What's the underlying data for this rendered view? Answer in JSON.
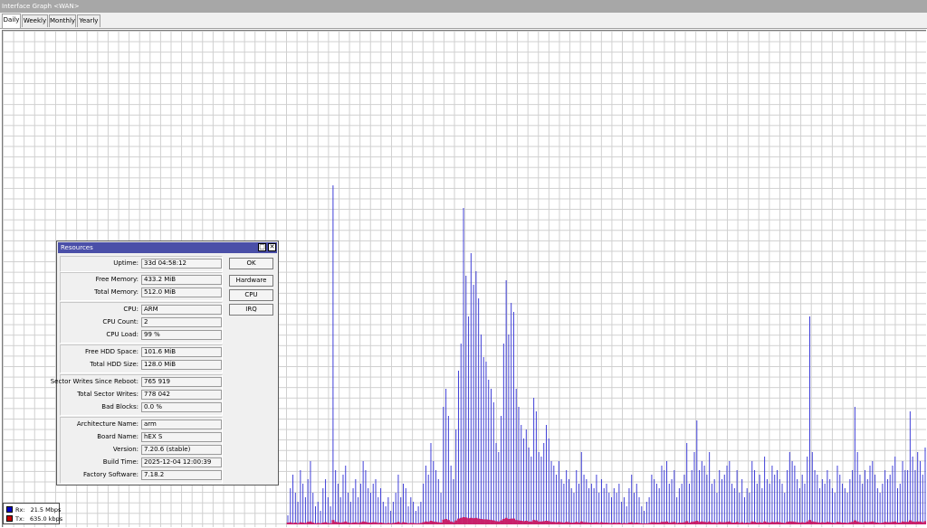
{
  "window": {
    "title": "Interface Graph <WAN>"
  },
  "tabs": [
    {
      "label": "Daily",
      "active": true
    },
    {
      "label": "Weekly",
      "active": false
    },
    {
      "label": "Monthly",
      "active": false
    },
    {
      "label": "Yearly",
      "active": false
    }
  ],
  "legend": {
    "rx": {
      "label": "Rx:",
      "value": "21.5 Mbps",
      "color": "#0000c8"
    },
    "tx": {
      "label": "Tx:",
      "value": "635.0 kbps",
      "color": "#c80000"
    }
  },
  "graph_colors": {
    "rx_stroke": "#4040d8",
    "tx_fill": "#c8206a",
    "grid": "#cfcfcf"
  },
  "chart_data": {
    "type": "bar",
    "rx_series": [
      2,
      8,
      11,
      7,
      5,
      12,
      9,
      6,
      10,
      14,
      7,
      4,
      5,
      3,
      8,
      10,
      6,
      4,
      75,
      12,
      9,
      6,
      11,
      13,
      7,
      5,
      8,
      10,
      6,
      9,
      14,
      12,
      8,
      7,
      9,
      10,
      6,
      8,
      5,
      4,
      6,
      3,
      5,
      7,
      11,
      6,
      9,
      8,
      4,
      6,
      5,
      3,
      4,
      5,
      9,
      13,
      11,
      18,
      14,
      12,
      10,
      7,
      26,
      30,
      24,
      13,
      10,
      21,
      34,
      40,
      70,
      55,
      46,
      60,
      53,
      56,
      50,
      42,
      37,
      36,
      32,
      30,
      27,
      18,
      16,
      24,
      40,
      54,
      42,
      49,
      47,
      30,
      26,
      22,
      19,
      21,
      17,
      15,
      28,
      25,
      16,
      15,
      18,
      22,
      19,
      14,
      13,
      11,
      14,
      10,
      9,
      12,
      10,
      8,
      7,
      12,
      9,
      16,
      11,
      10,
      8,
      9,
      8,
      11,
      7,
      10,
      8,
      9,
      7,
      6,
      8,
      7,
      9,
      5,
      6,
      4,
      8,
      11,
      7,
      9,
      6,
      4,
      3,
      5,
      6,
      11,
      10,
      9,
      8,
      13,
      12,
      14,
      9,
      10,
      12,
      6,
      8,
      9,
      11,
      18,
      9,
      12,
      16,
      23,
      12,
      14,
      13,
      11,
      16,
      9,
      10,
      7,
      12,
      10,
      11,
      13,
      14,
      9,
      8,
      12,
      7,
      10,
      6,
      8,
      7,
      14,
      12,
      9,
      11,
      8,
      15,
      10,
      9,
      13,
      11,
      12,
      10,
      9,
      7,
      12,
      16,
      14,
      13,
      10,
      8,
      11,
      9,
      15,
      46,
      16,
      12,
      11,
      8,
      10,
      9,
      12,
      10,
      8,
      7,
      13,
      11,
      9,
      8,
      7,
      10,
      12,
      26,
      16,
      11,
      9,
      12,
      10,
      13,
      14,
      11,
      8,
      7,
      9,
      12,
      10,
      11,
      13,
      15,
      8,
      9,
      14,
      12,
      12,
      25,
      15,
      12,
      16,
      14,
      11,
      17
    ],
    "tx_series": [
      0.5,
      0.6,
      0.4,
      0.5,
      0.3,
      0.6,
      0.5,
      0.4,
      0.7,
      0.8,
      0.5,
      0.3,
      0.4,
      0.3,
      0.5,
      0.6,
      0.4,
      0.3,
      1.2,
      0.7,
      0.6,
      0.5,
      0.6,
      0.8,
      0.5,
      0.4,
      0.5,
      0.6,
      0.4,
      0.6,
      0.8,
      0.7,
      0.5,
      0.5,
      0.6,
      0.6,
      0.4,
      0.5,
      0.4,
      0.3,
      0.4,
      0.3,
      0.4,
      0.5,
      0.7,
      0.4,
      0.6,
      0.5,
      0.3,
      0.4,
      0.4,
      0.3,
      0.3,
      0.4,
      0.6,
      0.8,
      0.7,
      1.0,
      0.8,
      0.7,
      0.6,
      0.5,
      1.3,
      1.5,
      1.2,
      0.8,
      0.6,
      1.1,
      1.6,
      1.8,
      2.0,
      1.9,
      1.7,
      1.8,
      1.7,
      1.8,
      1.6,
      1.5,
      1.4,
      1.4,
      1.3,
      1.2,
      1.1,
      0.9,
      0.8,
      1.1,
      1.5,
      1.8,
      1.5,
      1.6,
      1.6,
      1.2,
      1.1,
      1.0,
      0.9,
      1.0,
      0.8,
      0.8,
      1.2,
      1.1,
      0.8,
      0.8,
      0.9,
      1.0,
      0.9,
      0.7,
      0.7,
      0.6,
      0.7,
      0.6,
      0.5,
      0.7,
      0.6,
      0.5,
      0.5,
      0.7,
      0.5,
      0.8,
      0.6,
      0.6,
      0.5,
      0.5,
      0.5,
      0.6,
      0.4,
      0.6,
      0.5,
      0.5,
      0.4,
      0.4,
      0.5,
      0.4,
      0.5,
      0.3,
      0.4,
      0.3,
      0.5,
      0.6,
      0.4,
      0.5,
      0.4,
      0.3,
      0.3,
      0.3,
      0.4,
      0.6,
      0.6,
      0.5,
      0.5,
      0.7,
      0.7,
      0.8,
      0.5,
      0.6,
      0.7,
      0.4,
      0.5,
      0.5,
      0.6,
      0.9,
      0.5,
      0.7,
      0.8,
      1.0,
      0.7,
      0.8,
      0.7,
      0.6,
      0.8,
      0.5,
      0.6,
      0.4,
      0.7,
      0.6,
      0.6,
      0.7,
      0.8,
      0.5,
      0.5,
      0.7,
      0.4,
      0.6,
      0.4,
      0.5,
      0.4,
      0.8,
      0.7,
      0.5,
      0.6,
      0.5,
      0.8,
      0.6,
      0.5,
      0.7,
      0.6,
      0.7,
      0.6,
      0.5,
      0.4,
      0.7,
      0.8,
      0.8,
      0.7,
      0.6,
      0.5,
      0.6,
      0.5,
      0.8,
      1.2,
      0.8,
      0.7,
      0.6,
      0.5,
      0.6,
      0.5,
      0.7,
      0.6,
      0.5,
      0.4,
      0.7,
      0.6,
      0.5,
      0.5,
      0.4,
      0.6,
      0.7,
      1.1,
      0.8,
      0.6,
      0.5,
      0.7,
      0.6,
      0.7,
      0.8,
      0.6,
      0.5,
      0.4,
      0.5,
      0.7,
      0.6,
      0.6,
      0.7,
      0.8,
      0.5,
      0.5,
      0.8,
      0.7,
      0.7,
      1.1,
      0.8,
      0.7,
      0.8,
      0.8,
      0.6,
      0.9
    ]
  },
  "dialog": {
    "title": "Resources",
    "groups": [
      {
        "fields": [
          {
            "label": "Uptime:",
            "value": "33d 04:58:12"
          }
        ]
      },
      {
        "fields": [
          {
            "label": "Free Memory:",
            "value": "433.2 MiB"
          },
          {
            "label": "Total Memory:",
            "value": "512.0 MiB"
          }
        ]
      },
      {
        "fields": [
          {
            "label": "CPU:",
            "value": "ARM"
          },
          {
            "label": "CPU Count:",
            "value": "2"
          },
          {
            "label": "CPU Load:",
            "value": "99 %"
          }
        ]
      },
      {
        "fields": [
          {
            "label": "Free HDD Space:",
            "value": "101.6 MiB"
          },
          {
            "label": "Total HDD Size:",
            "value": "128.0 MiB"
          }
        ]
      },
      {
        "fields": [
          {
            "label": "Sector Writes Since Reboot:",
            "value": "765 919"
          },
          {
            "label": "Total Sector Writes:",
            "value": "778 042"
          },
          {
            "label": "Bad Blocks:",
            "value": "0.0 %"
          }
        ]
      },
      {
        "fields": [
          {
            "label": "Architecture Name:",
            "value": "arm"
          },
          {
            "label": "Board Name:",
            "value": "hEX S"
          },
          {
            "label": "Version:",
            "value": "7.20.6 (stable)"
          },
          {
            "label": "Build Time:",
            "value": "2025-12-04 12:00:39"
          },
          {
            "label": "Factory Software:",
            "value": "7.18.2"
          }
        ]
      }
    ],
    "buttons": {
      "ok": "OK",
      "hardware": "Hardware",
      "cpu": "CPU",
      "irq": "IRQ"
    }
  }
}
